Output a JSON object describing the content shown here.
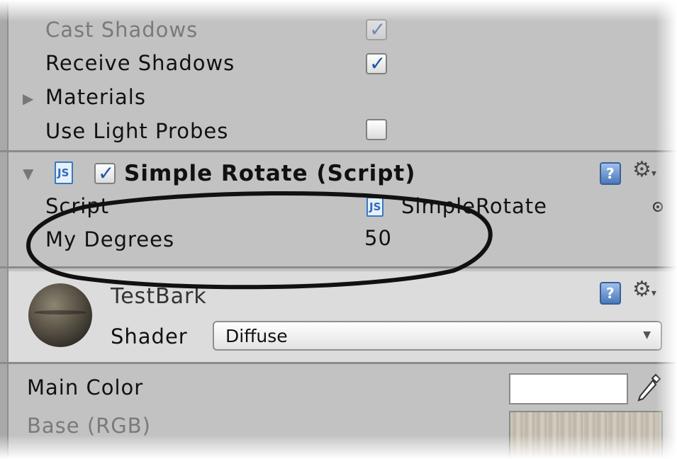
{
  "mesh_renderer": {
    "cast_shadows_label": "Cast Shadows",
    "cast_shadows_checked": true,
    "receive_shadows_label": "Receive Shadows",
    "receive_shadows_checked": true,
    "materials_label": "Materials",
    "use_light_probes_label": "Use Light Probes",
    "use_light_probes_checked": false
  },
  "script_component": {
    "file_icon_text": "JS",
    "enabled": true,
    "title": "Simple Rotate  (Script)",
    "script_label": "Script",
    "script_value": "SimpleRotate",
    "my_degrees_label": "My Degrees",
    "my_degrees_value": "50"
  },
  "material": {
    "name": "TestBark",
    "shader_label": "Shader",
    "shader_value": "Diffuse",
    "main_color_label": "Main Color",
    "main_color_value": "#ffffff",
    "base_label": "Base (RGB)"
  },
  "icons": {
    "help": "?",
    "gear": "⚙",
    "check": "✓",
    "collapsed_arrow": "▶",
    "expanded_arrow": "▼",
    "dropdown_arrow": "▼"
  },
  "colors": {
    "panel": "#c2c2c2",
    "header": "#dcdcdc",
    "accent": "#1f55a8"
  }
}
